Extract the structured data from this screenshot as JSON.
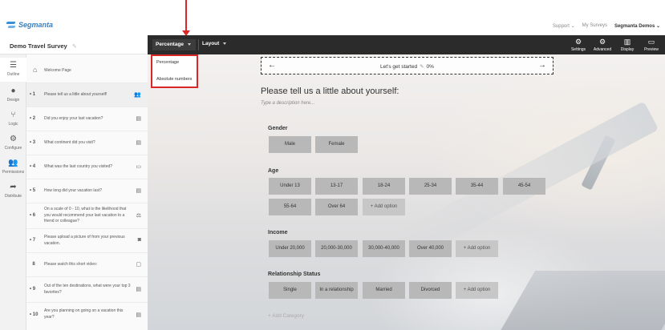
{
  "brand": {
    "name": "Segmanta"
  },
  "top_links": {
    "support": "Support ⌄",
    "my_surveys": "My Surveys",
    "account": "Segmanta Demos ⌄"
  },
  "survey": {
    "title": "Demo Travel Survey"
  },
  "rail": [
    {
      "label": "Outline",
      "icon": "list-icon"
    },
    {
      "label": "Design",
      "icon": "drop-icon"
    },
    {
      "label": "Logic",
      "icon": "branch-icon"
    },
    {
      "label": "Configure",
      "icon": "gear-icon"
    },
    {
      "label": "Permissions",
      "icon": "people-icon"
    },
    {
      "label": "Distribute",
      "icon": "share-icon"
    }
  ],
  "questions": [
    {
      "num": "",
      "text": "Welcome Page",
      "icon": "home-icon"
    },
    {
      "num": "1",
      "text": "Please tell us a little about yourself!",
      "icon": "people-icon"
    },
    {
      "num": "2",
      "text": "Did you enjoy your last vacation?",
      "icon": "list-icon"
    },
    {
      "num": "3",
      "text": "What continent did you visit?",
      "icon": "list-icon"
    },
    {
      "num": "4",
      "text": "What was the last country you visited?",
      "icon": "text-icon"
    },
    {
      "num": "5",
      "text": "How long did your vacation last?",
      "icon": "list-icon"
    },
    {
      "num": "6",
      "text": "On a scale of 0 - 10, what is the likelihood that you would recommend your last vacation to a friend or colleague?",
      "icon": "scale-icon"
    },
    {
      "num": "7",
      "text": "Please upload a picture of from your previous vacation.",
      "icon": "camera-icon"
    },
    {
      "num": "8",
      "text": "Please watch this short video:",
      "icon": "video-icon"
    },
    {
      "num": "9",
      "text": "Out of the ten destinations, what were your top 3 favorites?",
      "icon": "list-icon"
    },
    {
      "num": "10",
      "text": "Are you planning on going on a vacation this year?",
      "icon": "list-icon"
    }
  ],
  "toolbar": {
    "percentage": "Percentage",
    "layout": "Layout",
    "tools": [
      {
        "label": "Settings",
        "icon": "gear-icon"
      },
      {
        "label": "Advanced",
        "icon": "gears-icon"
      },
      {
        "label": "Display",
        "icon": "layout-icon"
      },
      {
        "label": "Preview",
        "icon": "monitor-icon"
      }
    ]
  },
  "dropdown": {
    "items": [
      "Percentage",
      "Absolute numbers"
    ]
  },
  "progress": {
    "text": "Let's get started",
    "percent": "0%"
  },
  "question": {
    "title": "Please tell us a little about yourself:",
    "description": "Type a description here..."
  },
  "categories": [
    {
      "label": "Gender",
      "options": [
        "Male",
        "Female"
      ]
    },
    {
      "label": "Age",
      "options": [
        "Under 13",
        "13-17",
        "18-24",
        "25-34",
        "35-44",
        "45-54",
        "55-64",
        "Over 64"
      ]
    },
    {
      "label": "Income",
      "options": [
        "Under 20,000",
        "20,000-30,000",
        "30,000-40,000",
        "Over 40,000"
      ]
    },
    {
      "label": "Relationship Status",
      "options": [
        "Single",
        "In a relationship",
        "Married",
        "Divorced"
      ]
    }
  ],
  "add_option": "+ Add option",
  "add_category": "+ Add Category"
}
